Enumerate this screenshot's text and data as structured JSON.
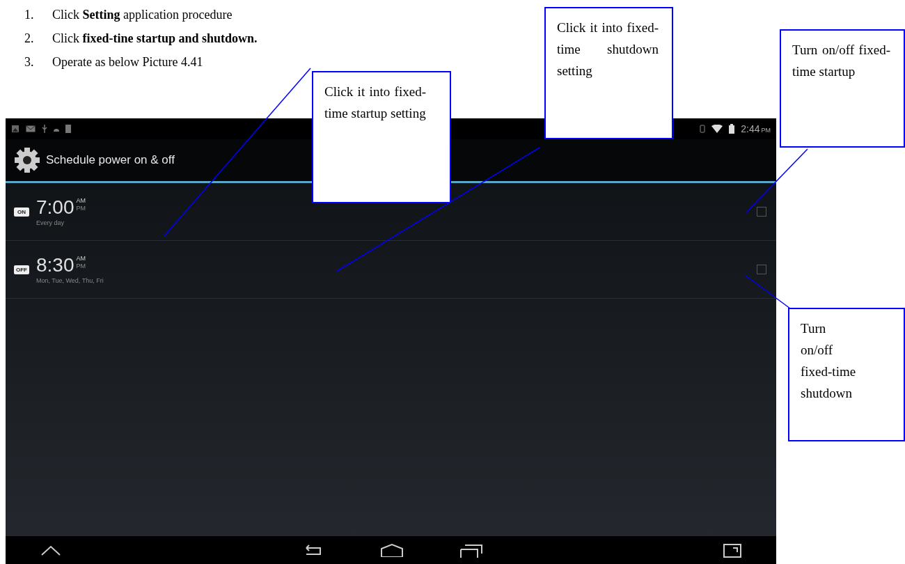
{
  "steps": [
    {
      "number": "1.",
      "text": "Click **Setting** application procedure"
    },
    {
      "number": "2.",
      "text": "Click **fixed-tine startup and shutdown.**"
    },
    {
      "number": "3.",
      "text": "Operate as below Picture 4.41"
    }
  ],
  "screen": {
    "status_bar": {
      "time": "2:44",
      "period": "PM"
    },
    "action_bar": {
      "title": "Schedule power on & off"
    },
    "schedules": [
      {
        "badge": "ON",
        "time": "7:00",
        "am": "AM",
        "pm": "PM",
        "repeat": "Every day",
        "checked": false
      },
      {
        "badge": "OFF",
        "time": "8:30",
        "am": "AM",
        "pm": "PM",
        "repeat": "Mon, Tue, Wed, Thu, Fri",
        "checked": false
      }
    ]
  },
  "callouts": [
    {
      "text": "Click it into fixed-time startup setting"
    },
    {
      "text": "Click it into fixed-time shutdown setting"
    },
    {
      "text": "Turn on/off fixed-time startup"
    },
    {
      "text": "Turn on/off fixed-time shutdown"
    }
  ]
}
